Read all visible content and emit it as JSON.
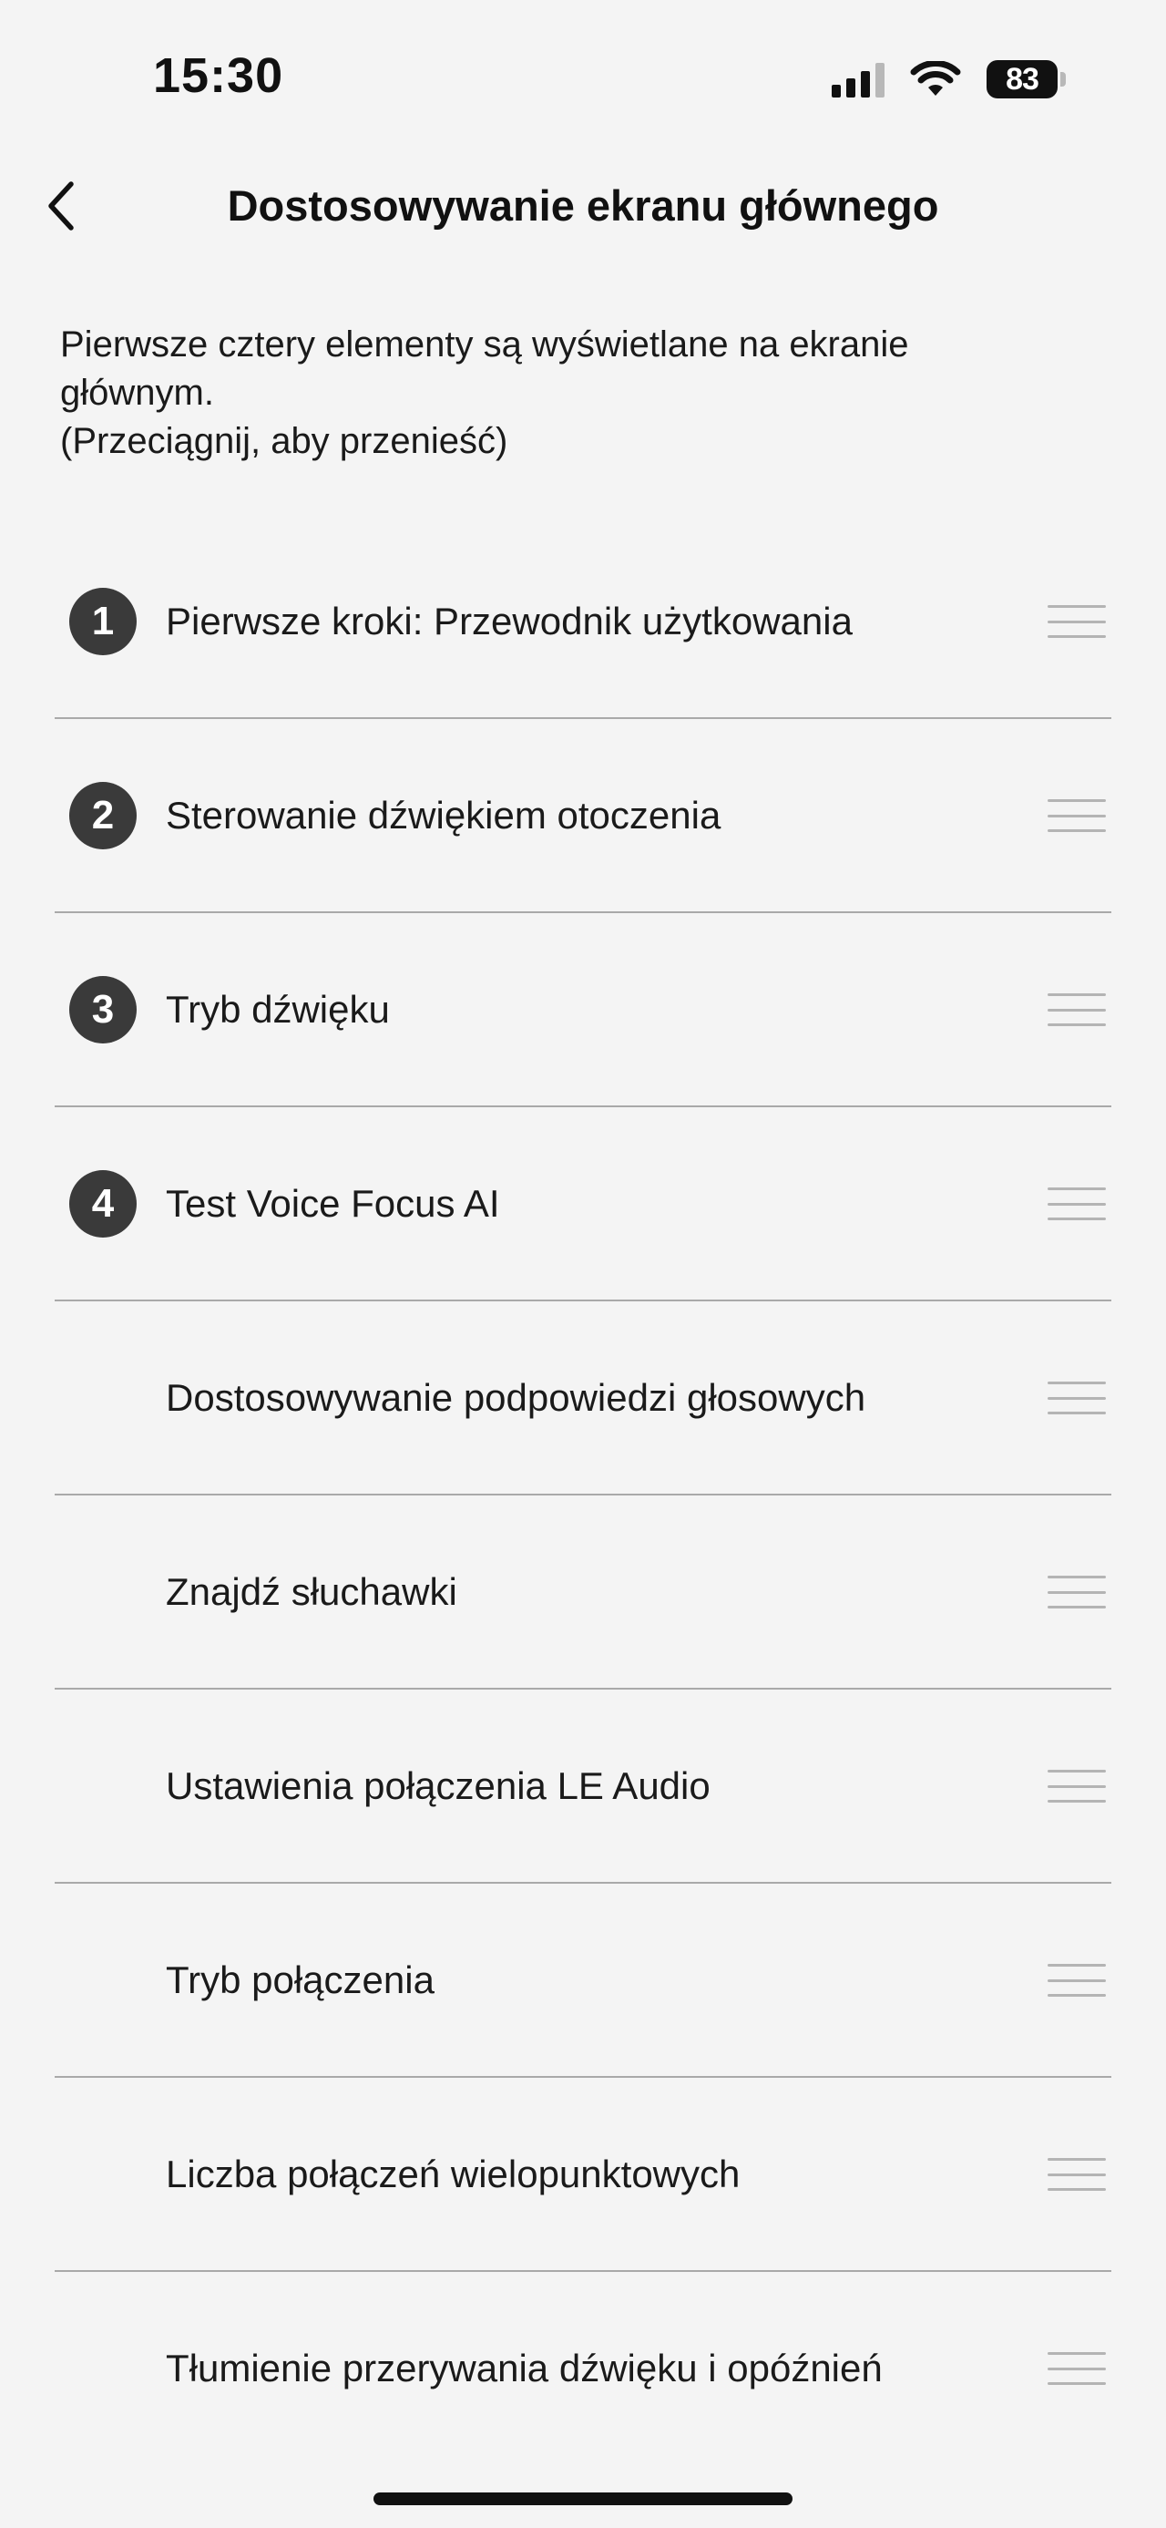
{
  "status_bar": {
    "time": "15:30",
    "battery_level": "83",
    "icons": [
      "cellular-signal-icon",
      "wifi-icon",
      "battery-icon"
    ]
  },
  "nav": {
    "title": "Dostosowywanie ekranu głównego",
    "back_icon": "chevron-left-icon"
  },
  "intro": {
    "line1": "Pierwsze cztery elementy są wyświetlane na ekranie głównym.",
    "line2": "(Przeciągnij, aby przenieść)"
  },
  "items": [
    {
      "number": "1",
      "label": "Pierwsze kroki: Przewodnik użytkowania"
    },
    {
      "number": "2",
      "label": "Sterowanie dźwiękiem otoczenia"
    },
    {
      "number": "3",
      "label": "Tryb dźwięku"
    },
    {
      "number": "4",
      "label": "Test Voice Focus AI"
    },
    {
      "number": "",
      "label": "Dostosowywanie podpowiedzi głosowych"
    },
    {
      "number": "",
      "label": "Znajdź słuchawki"
    },
    {
      "number": "",
      "label": "Ustawienia połączenia LE Audio"
    },
    {
      "number": "",
      "label": "Tryb połączenia"
    },
    {
      "number": "",
      "label": "Liczba połączeń wielopunktowych"
    },
    {
      "number": "",
      "label": "Tłumienie przerywania dźwięku i opóźnień"
    }
  ],
  "colors": {
    "background": "#f4f4f4",
    "badge": "#3a3a3a",
    "divider": "#a9a9a9",
    "handle": "#b4b4b4",
    "text": "#1a1a1a"
  }
}
